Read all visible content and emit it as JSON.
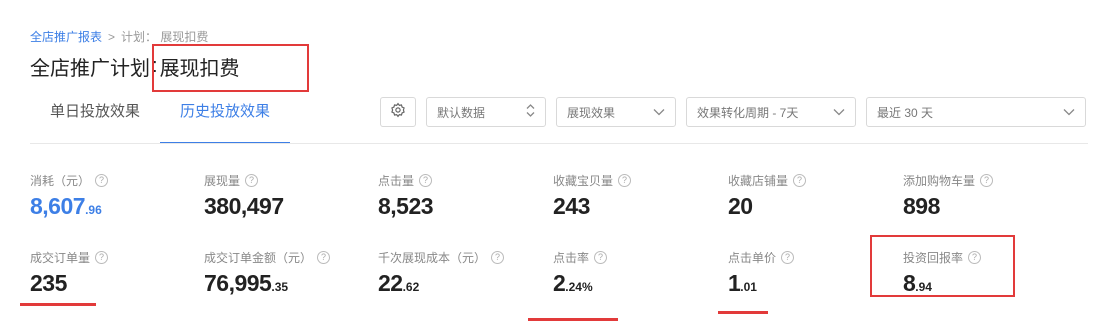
{
  "breadcrumb": {
    "parent": "全店推广报表",
    "current": "计划： 展现扣费"
  },
  "page_title": {
    "prefix": "全店推广计划",
    "colon": ":",
    "name": "展现扣费"
  },
  "tabs": [
    {
      "label": "单日投放效果",
      "active": false
    },
    {
      "label": "历史投放效果",
      "active": true
    }
  ],
  "toolbar": {
    "settings_icon": "gear-icon",
    "selects": [
      {
        "value": "默认数据"
      },
      {
        "value": "展现效果"
      },
      {
        "value": "效果转化周期 - 7天"
      },
      {
        "value": "最近 30 天"
      }
    ]
  },
  "metrics": {
    "cost": {
      "label": "消耗（元）",
      "int": "8,607",
      "dec": ".96",
      "highlight_color": "#3d7fe6"
    },
    "impressions": {
      "label": "展现量",
      "int": "380,497",
      "dec": ""
    },
    "clicks": {
      "label": "点击量",
      "int": "8,523",
      "dec": ""
    },
    "fav_items": {
      "label": "收藏宝贝量",
      "int": "243",
      "dec": ""
    },
    "fav_shops": {
      "label": "收藏店铺量",
      "int": "20",
      "dec": ""
    },
    "cart_adds": {
      "label": "添加购物车量",
      "int": "898",
      "dec": ""
    },
    "orders": {
      "label": "成交订单量",
      "int": "235",
      "dec": ""
    },
    "order_amount": {
      "label": "成交订单金额（元）",
      "int": "76,995",
      "dec": ".35"
    },
    "cpm": {
      "label": "千次展现成本（元）",
      "int": "22",
      "dec": ".62"
    },
    "ctr": {
      "label": "点击率",
      "int": "2",
      "dec": ".24%"
    },
    "cpc": {
      "label": "点击单价",
      "int": "1",
      "dec": ".01"
    },
    "roi": {
      "label": "投资回报率",
      "int": "8",
      "dec": ".94"
    }
  },
  "help_glyph": "?",
  "annotation_color": "#e23a3a"
}
